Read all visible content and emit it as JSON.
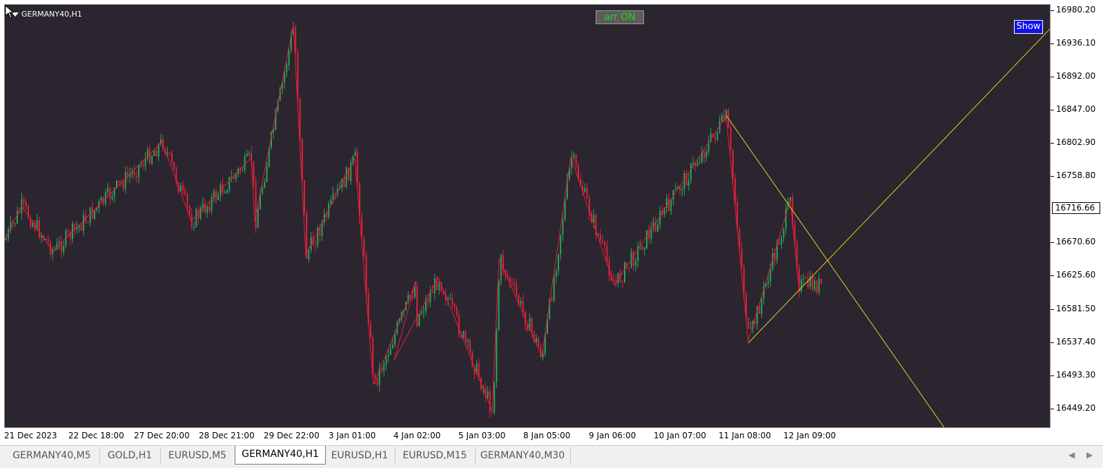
{
  "chart": {
    "symbol_title": "GERMANY40,H1",
    "arr_button_label": "arr ON",
    "show_button_label": "Show",
    "current_price": "16716.66"
  },
  "price_axis": {
    "labels": [
      "16980.20",
      "16936.10",
      "16892.00",
      "16847.00",
      "16802.90",
      "16758.80",
      "16670.60",
      "16625.60",
      "16581.50",
      "16537.40",
      "16493.30",
      "16449.20"
    ]
  },
  "time_axis": {
    "labels": [
      "21 Dec 2023",
      "22 Dec 18:00",
      "27 Dec 20:00",
      "28 Dec 21:00",
      "29 Dec 22:00",
      "3 Jan 01:00",
      "4 Jan 02:00",
      "5 Jan 03:00",
      "8 Jan 05:00",
      "9 Jan 06:00",
      "10 Jan 07:00",
      "11 Jan 08:00",
      "12 Jan 09:00"
    ]
  },
  "tabs": [
    {
      "label": "GERMANY40,M5",
      "active": false
    },
    {
      "label": "GOLD,H1",
      "active": false
    },
    {
      "label": "EURUSD,M5",
      "active": false
    },
    {
      "label": "GERMANY40,H1",
      "active": true
    },
    {
      "label": "EURUSD,H1",
      "active": false
    },
    {
      "label": "EURUSD,M15",
      "active": false
    },
    {
      "label": "GERMANY40,M30",
      "active": false
    }
  ],
  "colors": {
    "background": "#2b2530",
    "bull_candle": "#26a65b",
    "bear_candle": "#e0213a",
    "zigzag": "#e0213a",
    "trendline": "#e6d21a"
  },
  "chart_data": {
    "type": "candlestick",
    "zigzag_points": [
      {
        "time": "21 Dec 2023",
        "price": 16675
      },
      {
        "time": "",
        "price": 16720
      },
      {
        "time": "",
        "price": 16660
      },
      {
        "time": "27 Dec 20:00",
        "price": 16806
      },
      {
        "time": "",
        "price": 16700
      },
      {
        "time": "28 Dec 21:00",
        "price": 16785
      },
      {
        "time": "",
        "price": 16700
      },
      {
        "time": "29 Dec 22:00",
        "price": 16962
      },
      {
        "time": "",
        "price": 16655
      },
      {
        "time": "3 Jan 01:00",
        "price": 16784
      },
      {
        "time": "",
        "price": 16482
      },
      {
        "time": "4 Jan 02:00",
        "price": 16620
      },
      {
        "time": "",
        "price": 16515
      },
      {
        "time": "",
        "price": 16625
      },
      {
        "time": "5 Jan 03:00",
        "price": 16447
      },
      {
        "time": "",
        "price": 16650
      },
      {
        "time": "",
        "price": 16520
      },
      {
        "time": "8 Jan 05:00",
        "price": 16786
      },
      {
        "time": "9 Jan 06:00",
        "price": 16615
      },
      {
        "time": "11 Jan 08:00",
        "price": 16840
      },
      {
        "time": "",
        "price": 16540
      },
      {
        "time": "12 Jan 09:00",
        "price": 16728
      },
      {
        "time": "",
        "price": 16615
      }
    ],
    "y_range": [
      16430,
      17000
    ]
  }
}
